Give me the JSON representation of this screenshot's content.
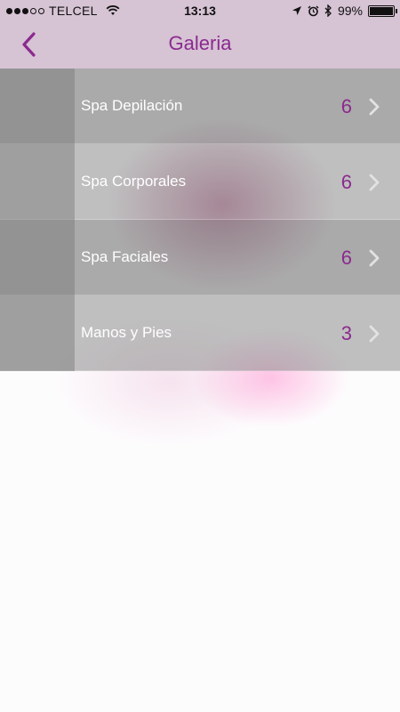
{
  "status_bar": {
    "carrier": "TELCEL",
    "time": "13:13",
    "battery": "99%",
    "battery_level": 0.99
  },
  "nav": {
    "title": "Galeria",
    "accent_color": "#8b2a8f"
  },
  "items": [
    {
      "label": "Spa Depilación",
      "count": "6"
    },
    {
      "label": "Spa Corporales",
      "count": "6"
    },
    {
      "label": "Spa Faciales",
      "count": "6"
    },
    {
      "label": "Manos y Pies",
      "count": "3"
    }
  ]
}
